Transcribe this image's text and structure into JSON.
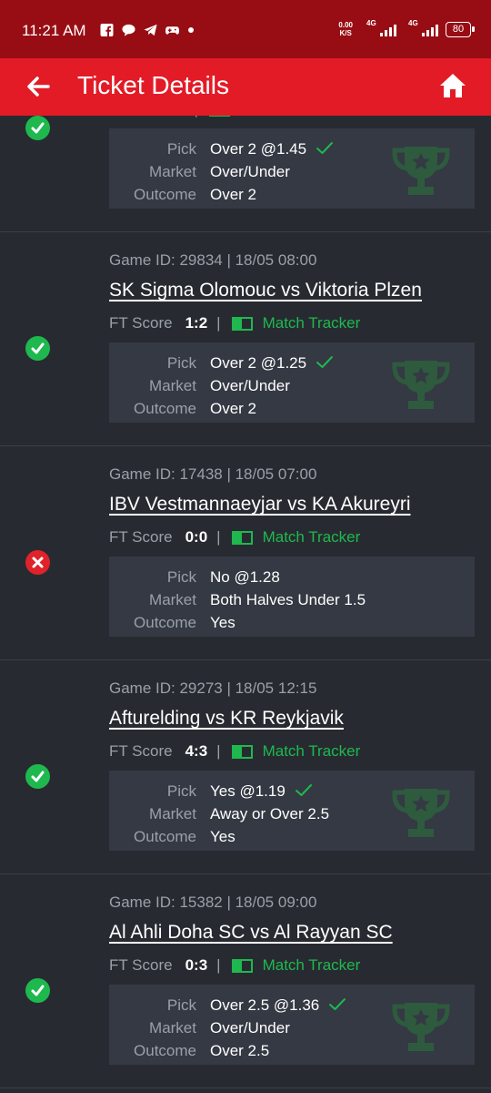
{
  "status_bar": {
    "time": "11:21 AM",
    "net_speed_value": "0.00",
    "net_speed_unit": "K/S",
    "sim1": "4G",
    "sim2": "4G",
    "battery": "80"
  },
  "header": {
    "title": "Ticket Details",
    "back_icon": "back-arrow-icon",
    "home_icon": "home-icon"
  },
  "labels": {
    "ft_score": "FT Score",
    "separator": "|",
    "match_tracker": "Match Tracker",
    "pick": "Pick",
    "market": "Market",
    "outcome": "Outcome"
  },
  "colors": {
    "header_red": "#e21b26",
    "status_red": "#980d14",
    "win_green": "#1fb84e",
    "loss_red": "#e0222b",
    "background": "#272b31",
    "panel": "#343943"
  },
  "bets": [
    {
      "status": "won",
      "game_id": "",
      "match": "",
      "ft_score": "",
      "pick": "Over 2 @1.45",
      "market": "Over/Under",
      "outcome": "Over 2"
    },
    {
      "status": "won",
      "game_id": "Game ID: 29834 | 18/05 08:00",
      "match": "SK Sigma Olomouc vs Viktoria Plzen",
      "ft_score": "1:2",
      "pick": "Over 2 @1.25",
      "market": "Over/Under",
      "outcome": "Over 2"
    },
    {
      "status": "lost",
      "game_id": "Game ID: 17438 | 18/05 07:00",
      "match": "IBV Vestmannaeyjar vs KA Akureyri",
      "ft_score": "0:0",
      "pick": "No @1.28",
      "market": "Both Halves Under 1.5",
      "outcome": "Yes"
    },
    {
      "status": "won",
      "game_id": "Game ID: 29273 | 18/05 12:15",
      "match": "Afturelding vs KR Reykjavik",
      "ft_score": "4:3",
      "pick": "Yes @1.19",
      "market": "Away or Over 2.5",
      "outcome": "Yes"
    },
    {
      "status": "won",
      "game_id": "Game ID: 15382 | 18/05 09:00",
      "match": "Al Ahli Doha SC vs Al Rayyan SC",
      "ft_score": "0:3",
      "pick": "Over 2.5 @1.36",
      "market": "Over/Under",
      "outcome": "Over 2.5"
    }
  ]
}
